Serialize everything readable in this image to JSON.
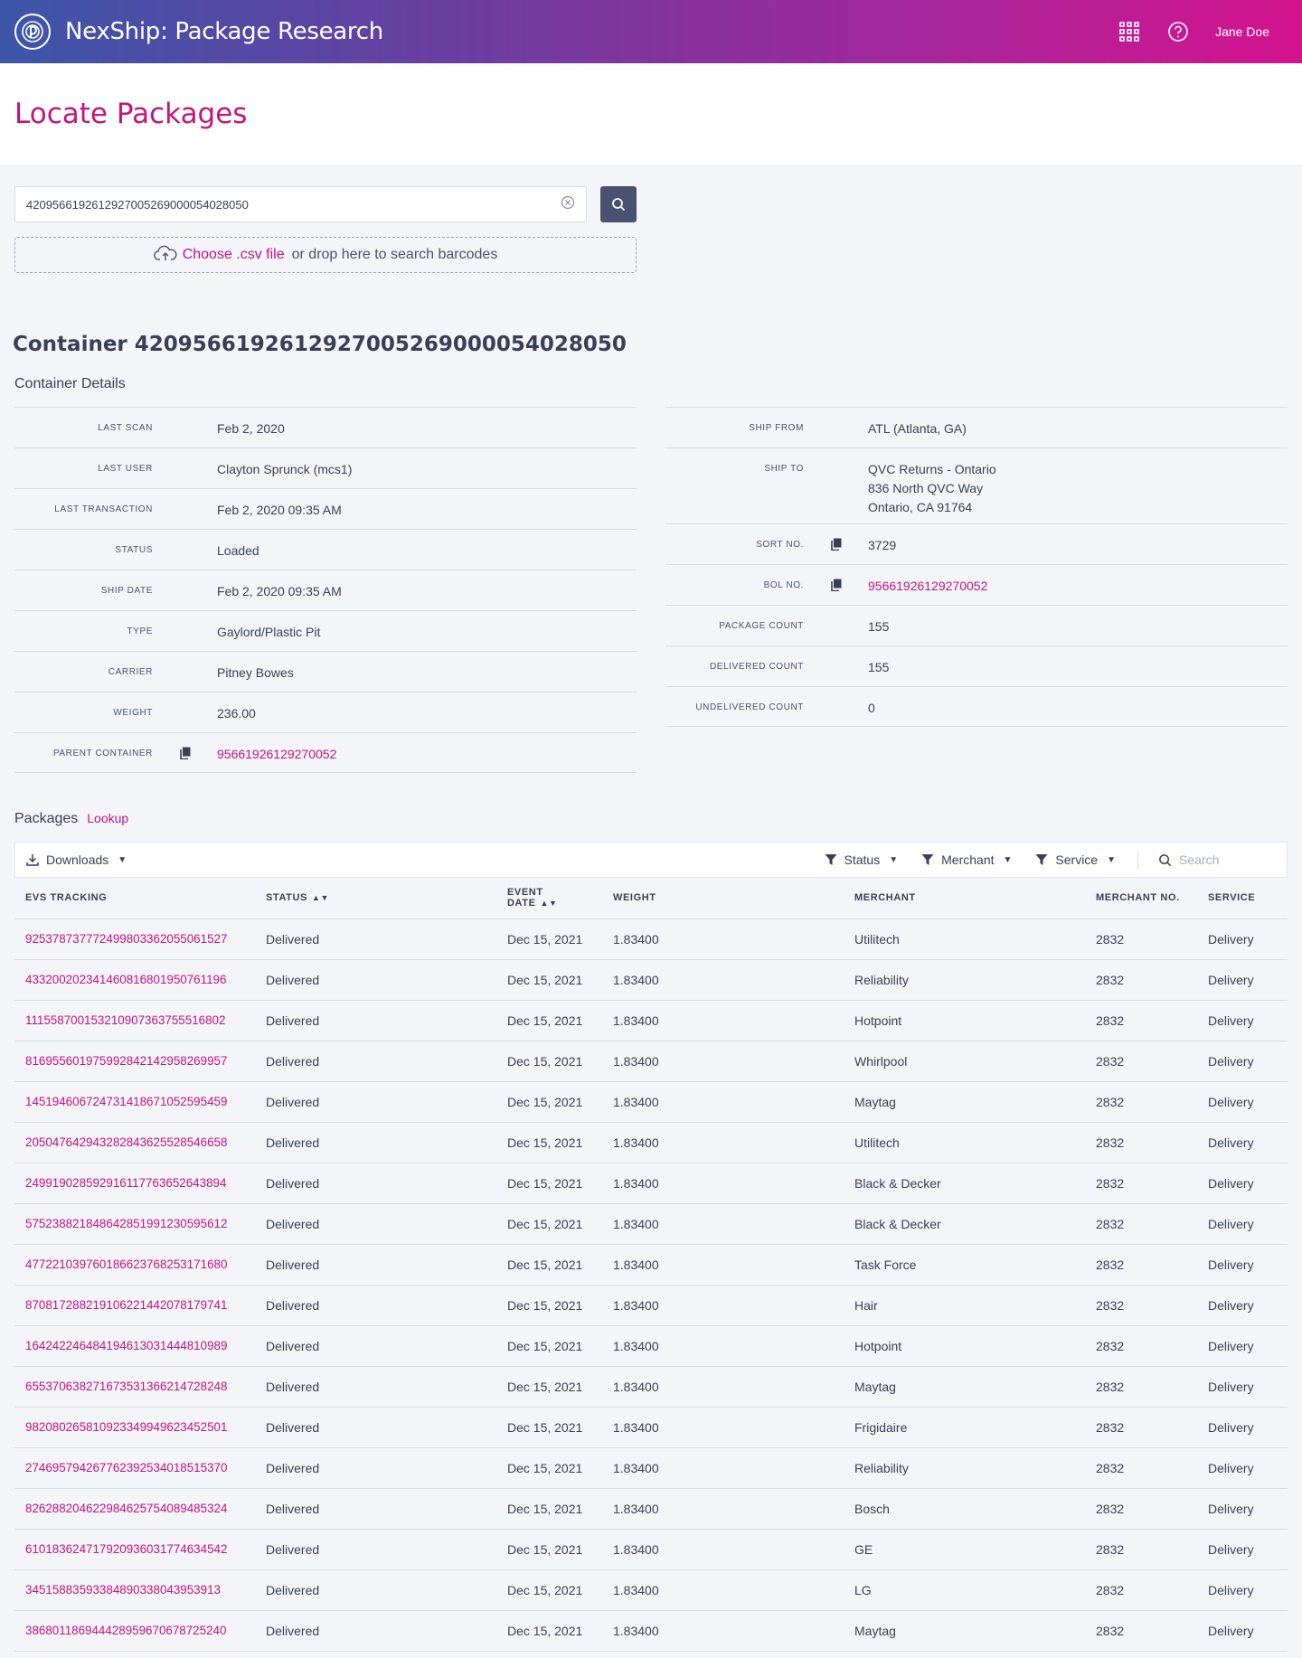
{
  "app": {
    "title": "NexShip: Package Research",
    "user": "Jane Doe"
  },
  "page": {
    "title": "Locate Packages"
  },
  "search": {
    "value": "420956619261292700526900005402805​0",
    "choose_label": "Choose .csv file",
    "drop_text": "or drop here to search barcodes"
  },
  "container": {
    "title": "Container 420956619261292700526900005402805​0",
    "details_label": "Container Details",
    "left": [
      {
        "label": "LAST SCAN",
        "value": "Feb 2, 2020"
      },
      {
        "label": "LAST USER",
        "value": "Clayton Sprunck (mcs1)"
      },
      {
        "label": "LAST TRANSACTION",
        "value": "Feb 2, 2020  09:35 AM"
      },
      {
        "label": "STATUS",
        "value": "Loaded"
      },
      {
        "label": "SHIP DATE",
        "value": "Feb 2, 2020  09:35 AM"
      },
      {
        "label": "TYPE",
        "value": "Gaylord/Plastic Pit"
      },
      {
        "label": "CARRIER",
        "value": "Pitney Bowes"
      },
      {
        "label": "WEIGHT",
        "value": "236.00"
      },
      {
        "label": "PARENT CONTAINER",
        "value": "95661926129270052"
      }
    ],
    "right": [
      {
        "label": "SHIP FROM",
        "value": "ATL (Atlanta, GA)"
      },
      {
        "label": "SHIP TO",
        "lines": [
          "QVC Returns - Ontario",
          "836 North QVC Way",
          "Ontario, CA 91764"
        ]
      },
      {
        "label": "SORT NO.",
        "value": "3729"
      },
      {
        "label": "BOL NO.",
        "value": "95661926129270052"
      },
      {
        "label": "PACKAGE COUNT",
        "value": "155"
      },
      {
        "label": "DELIVERED COUNT",
        "value": "155"
      },
      {
        "label": "UNDELIVERED COUNT",
        "value": "0"
      }
    ]
  },
  "packages": {
    "title": "Packages",
    "lookup": "Lookup",
    "toolbar": {
      "downloads": "Downloads",
      "status": "Status",
      "merchant": "Merchant",
      "service": "Service",
      "search_placeholder": "Search"
    },
    "columns": [
      "EVS TRACKING",
      "STATUS",
      "EVENT DATE",
      "WEIGHT",
      "MERCHANT",
      "MERCHANT NO.",
      "SERVICE"
    ],
    "rows": [
      [
        "9253787377724998033620550615​27",
        "Delivered",
        "Dec 15, 2021",
        "1.83400",
        "Utilitech",
        "2832",
        "Delivery"
      ],
      [
        "4332002023414608168019507611​96",
        "Delivered",
        "Dec 15, 2021",
        "1.83400",
        "Reliability",
        "2832",
        "Delivery"
      ],
      [
        "1115587001532109073637555168​02",
        "Delivered",
        "Dec 15, 2021",
        "1.83400",
        "Hotpoint",
        "2832",
        "Delivery"
      ],
      [
        "8169556019759928421429582699​57",
        "Delivered",
        "Dec 15, 2021",
        "1.83400",
        "Whirlpool",
        "2832",
        "Delivery"
      ],
      [
        "1451946067247314186710525954​59",
        "Delivered",
        "Dec 15, 2021",
        "1.83400",
        "Maytag",
        "2832",
        "Delivery"
      ],
      [
        "2050476429432828436255285466​58",
        "Delivered",
        "Dec 15, 2021",
        "1.83400",
        "Utilitech",
        "2832",
        "Delivery"
      ],
      [
        "2499190285929161177636526438​94",
        "Delivered",
        "Dec 15, 2021",
        "1.83400",
        "Black & Decker",
        "2832",
        "Delivery"
      ],
      [
        "5752388218486428519912305956​12",
        "Delivered",
        "Dec 15, 2021",
        "1.83400",
        "Black & Decker",
        "2832",
        "Delivery"
      ],
      [
        "4772210397601866237682531716​80",
        "Delivered",
        "Dec 15, 2021",
        "1.83400",
        "Task Force",
        "2832",
        "Delivery"
      ],
      [
        "8708172882191062214420781797​41",
        "Delivered",
        "Dec 15, 2021",
        "1.83400",
        "Hair",
        "2832",
        "Delivery"
      ],
      [
        "1642422464841946130314448109​89",
        "Delivered",
        "Dec 15, 2021",
        "1.83400",
        "Hotpoint",
        "2832",
        "Delivery"
      ],
      [
        "6553706382716735313662147282​48",
        "Delivered",
        "Dec 15, 2021",
        "1.83400",
        "Maytag",
        "2832",
        "Delivery"
      ],
      [
        "9820802658109233499496234525​01",
        "Delivered",
        "Dec 15, 2021",
        "1.83400",
        "Frigidaire",
        "2832",
        "Delivery"
      ],
      [
        "2746957942677623925340185153​70",
        "Delivered",
        "Dec 15, 2021",
        "1.83400",
        "Reliability",
        "2832",
        "Delivery"
      ],
      [
        "8262882046229846257540894853​24",
        "Delivered",
        "Dec 15, 2021",
        "1.83400",
        "Bosch",
        "2832",
        "Delivery"
      ],
      [
        "6101836247179209360317746345​42",
        "Delivered",
        "Dec 15, 2021",
        "1.83400",
        "GE",
        "2832",
        "Delivery"
      ],
      [
        "3451588359338489033804395391​3",
        "Delivered",
        "Dec 15, 2021",
        "1.83400",
        "LG",
        "2832",
        "Delivery"
      ],
      [
        "3868011869444289596706787252​40",
        "Delivered",
        "Dec 15, 2021",
        "1.83400",
        "Maytag",
        "2832",
        "Delivery"
      ]
    ]
  },
  "colors": {
    "accent": "#c4147f",
    "dark": "#4a5171",
    "text": "#3a3f56"
  }
}
